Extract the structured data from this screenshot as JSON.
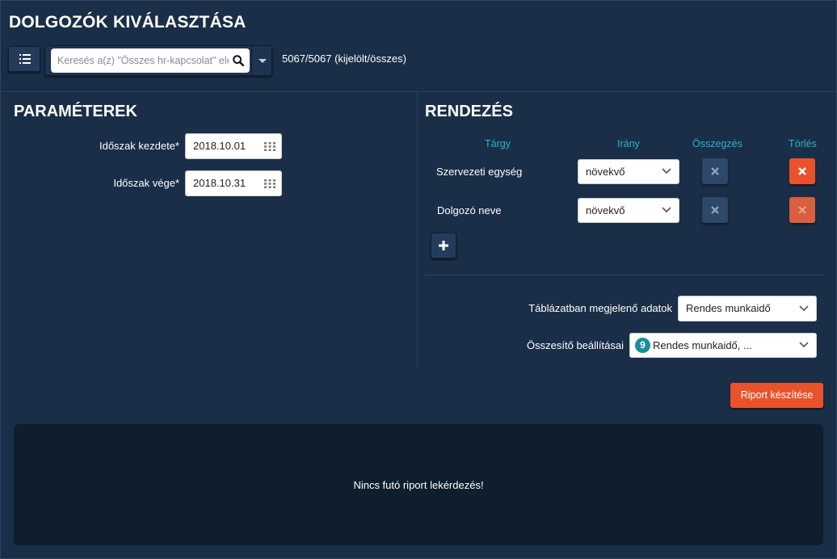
{
  "page": {
    "title": "DOLGOZÓK KIVÁLASZTÁSA",
    "search_placeholder": "Keresés a(z) \"Összes hr-kapcsolat\" elemei között",
    "count_text": "5067/5067 (kijelölt/összes)"
  },
  "params": {
    "heading": "PARAMÉTEREK",
    "start_label": "Időszak kezdete*",
    "start_value": "2018.10.01",
    "end_label": "Időszak vége*",
    "end_value": "2018.10.31"
  },
  "sorting": {
    "heading": "RENDEZÉS",
    "columns": {
      "subject": "Tárgy",
      "direction": "Irány",
      "summary": "Összegzés",
      "delete": "Törlés"
    },
    "rows": [
      {
        "subject": "Szervezeti egység",
        "direction": "növekvő"
      },
      {
        "subject": "Dolgozó neve",
        "direction": "növekvő"
      }
    ]
  },
  "settings": {
    "table_data_label": "Táblázatban megjelenő adatok",
    "table_data_value": "Rendes munkaidő",
    "summary_label": "Összesítő beállításai",
    "summary_badge": "9",
    "summary_value": "Rendes munkaidő, ..."
  },
  "actions": {
    "report_button": "Riport készítése"
  },
  "result": {
    "message": "Nincs futó riport lekérdezés!"
  },
  "colors": {
    "background": "#1a2e48",
    "accent_orange": "#e8532b",
    "header_teal": "#2bb3c7",
    "badge_teal": "#1b8f97",
    "panel_dark": "#0f1e2d"
  }
}
